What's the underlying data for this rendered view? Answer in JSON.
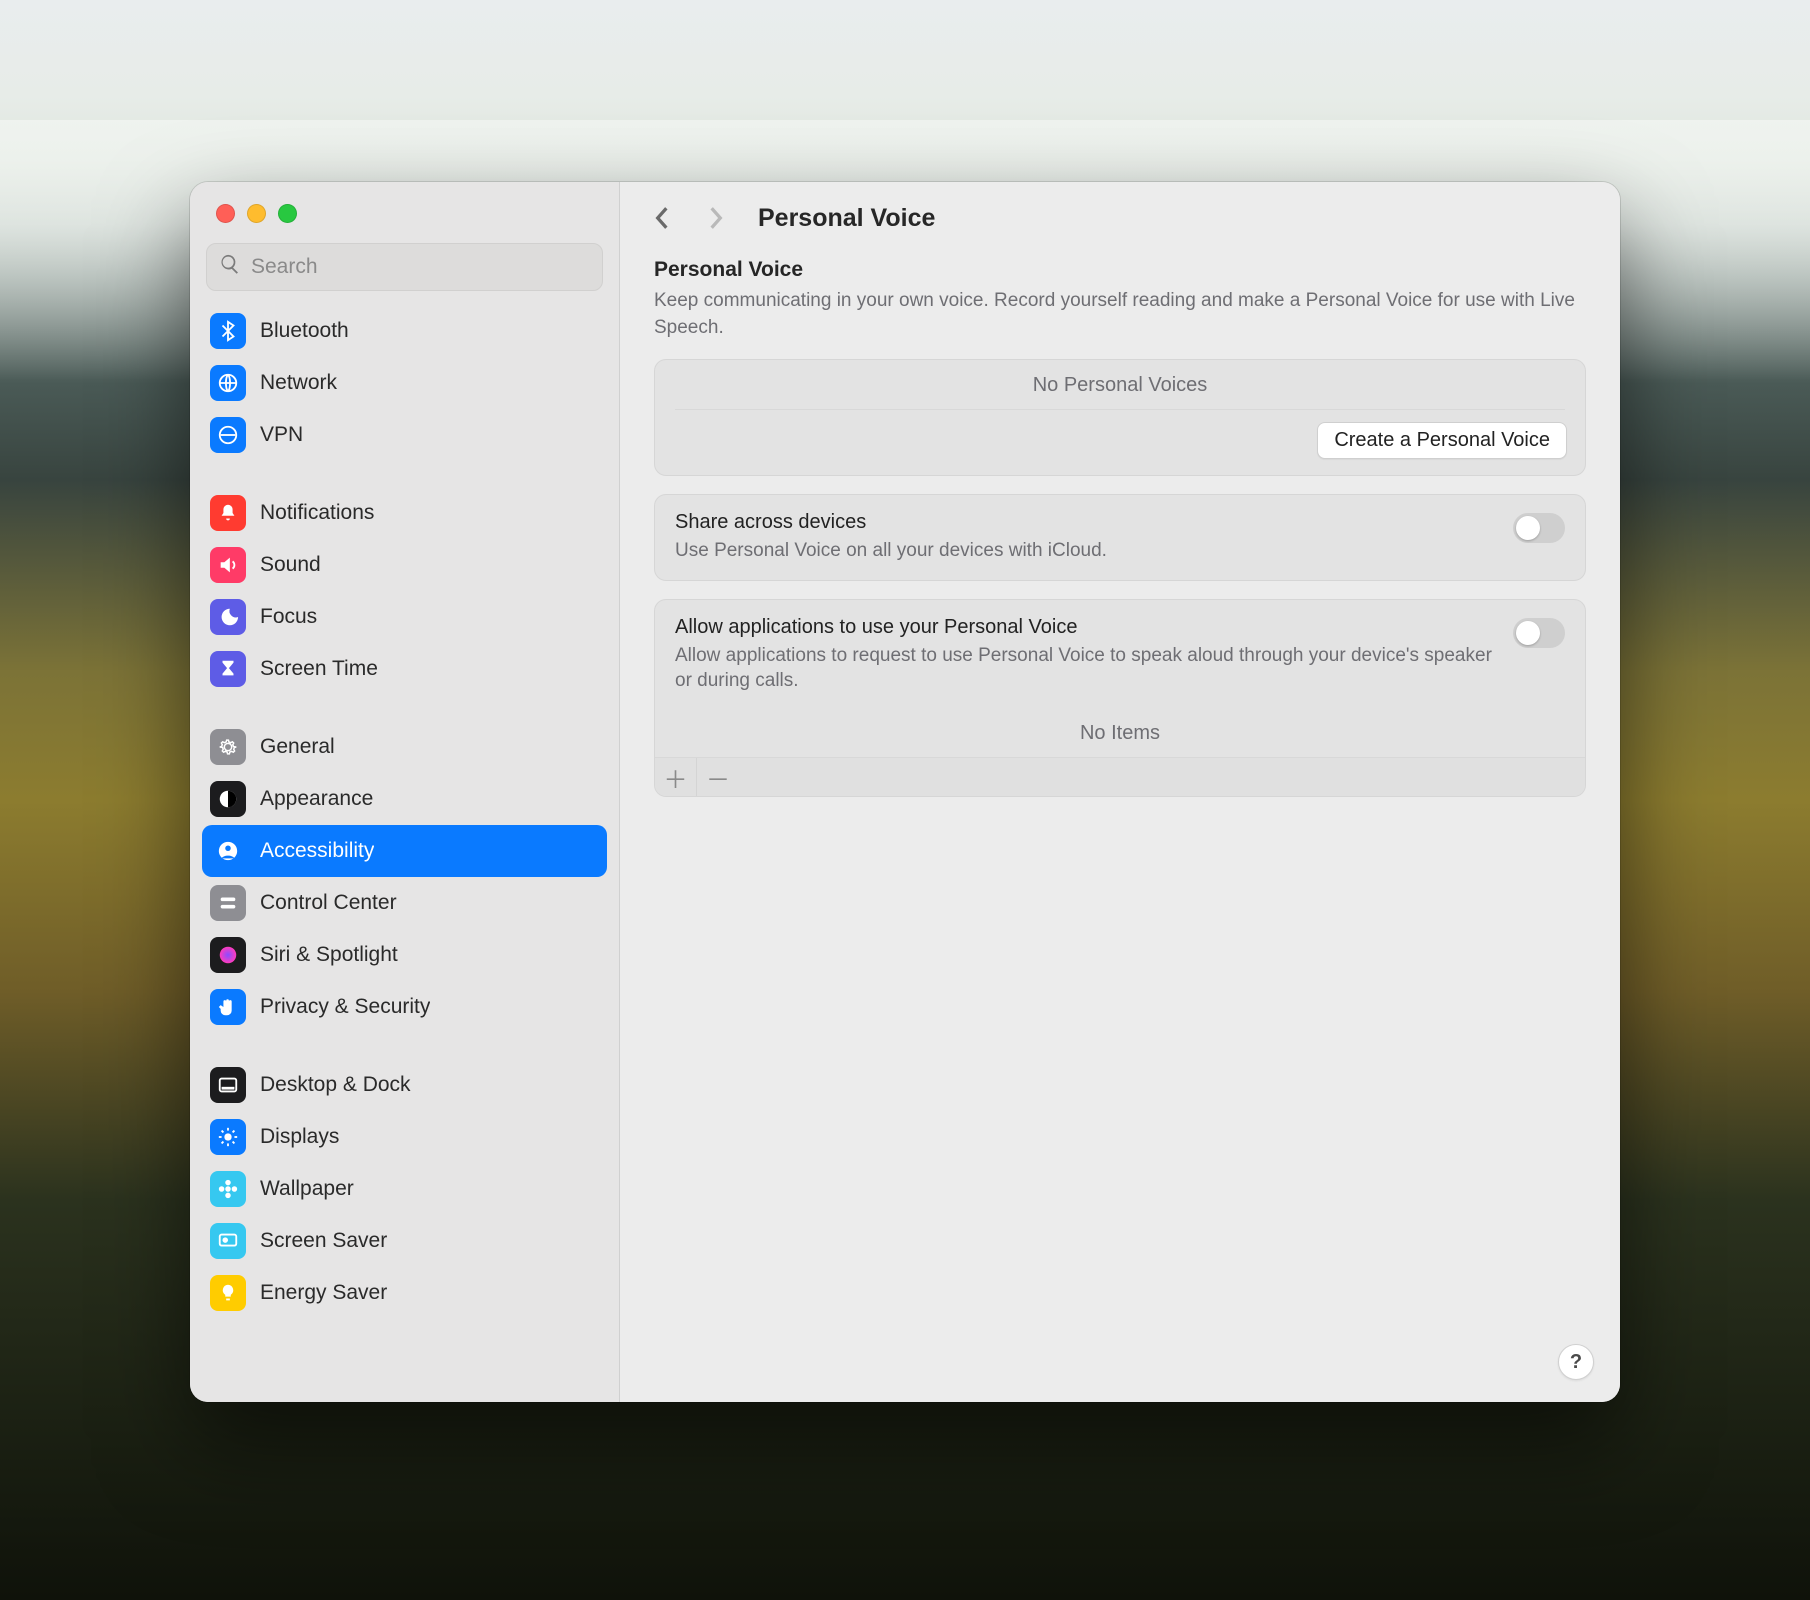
{
  "search": {
    "placeholder": "Search"
  },
  "sidebar": {
    "groups": [
      [
        {
          "id": "bluetooth",
          "label": "Bluetooth",
          "bg": "#0a7aff",
          "icon": "bluetooth"
        },
        {
          "id": "network",
          "label": "Network",
          "bg": "#0a7aff",
          "icon": "globe"
        },
        {
          "id": "vpn",
          "label": "VPN",
          "bg": "#0a7aff",
          "icon": "vpn"
        }
      ],
      [
        {
          "id": "notifications",
          "label": "Notifications",
          "bg": "#ff3b30",
          "icon": "bell"
        },
        {
          "id": "sound",
          "label": "Sound",
          "bg": "#ff3b67",
          "icon": "speaker"
        },
        {
          "id": "focus",
          "label": "Focus",
          "bg": "#5e5ce6",
          "icon": "moon"
        },
        {
          "id": "screentime",
          "label": "Screen Time",
          "bg": "#5e5ce6",
          "icon": "hourglass"
        }
      ],
      [
        {
          "id": "general",
          "label": "General",
          "bg": "#8e8e93",
          "icon": "gear"
        },
        {
          "id": "appearance",
          "label": "Appearance",
          "bg": "#1c1c1e",
          "icon": "contrast"
        },
        {
          "id": "accessibility",
          "label": "Accessibility",
          "bg": "#0a7aff",
          "icon": "person",
          "selected": true
        },
        {
          "id": "controlcenter",
          "label": "Control Center",
          "bg": "#8e8e93",
          "icon": "switches"
        },
        {
          "id": "siri",
          "label": "Siri & Spotlight",
          "bg": "#1c1c1e",
          "icon": "siri"
        },
        {
          "id": "privacy",
          "label": "Privacy & Security",
          "bg": "#0a7aff",
          "icon": "hand"
        }
      ],
      [
        {
          "id": "desktop",
          "label": "Desktop & Dock",
          "bg": "#1c1c1e",
          "icon": "dock"
        },
        {
          "id": "displays",
          "label": "Displays",
          "bg": "#0a7aff",
          "icon": "sun"
        },
        {
          "id": "wallpaper",
          "label": "Wallpaper",
          "bg": "#36c8f0",
          "icon": "flower"
        },
        {
          "id": "screensaver",
          "label": "Screen Saver",
          "bg": "#36c8f0",
          "icon": "screensaver"
        },
        {
          "id": "energy",
          "label": "Energy Saver",
          "bg": "#ffcc00",
          "icon": "bulb"
        }
      ]
    ]
  },
  "header": {
    "title": "Personal Voice"
  },
  "intro": {
    "title": "Personal Voice",
    "subtitle": "Keep communicating in your own voice. Record yourself reading and make a Personal Voice for use with Live Speech."
  },
  "voices": {
    "empty": "No Personal Voices",
    "create_label": "Create a Personal Voice"
  },
  "share": {
    "title": "Share across devices",
    "subtitle": "Use Personal Voice on all your devices with iCloud.",
    "on": false
  },
  "allow_apps": {
    "title": "Allow applications to use your Personal Voice",
    "subtitle": "Allow applications to request to use Personal Voice to speak aloud through your device's speaker or during calls.",
    "on": false,
    "empty": "No Items"
  },
  "help_label": "?"
}
